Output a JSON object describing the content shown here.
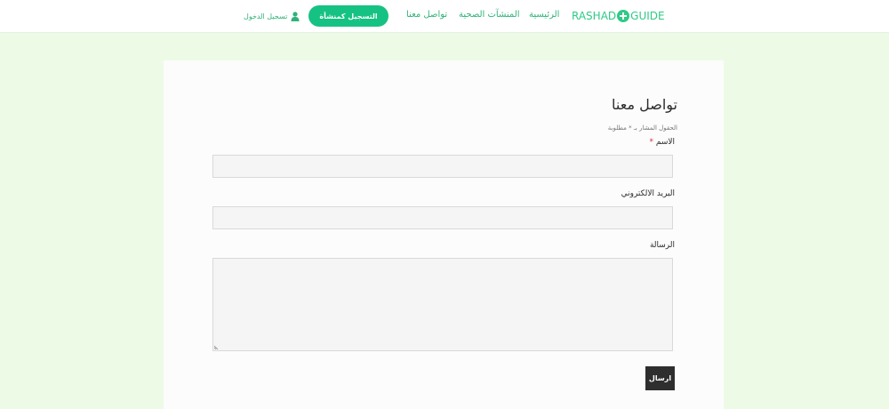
{
  "header": {
    "logo_left": "RASHAD",
    "logo_right": "GUIDE",
    "nav": {
      "home": "الرئيسية",
      "facilities": "المنشآت الصحية",
      "contact": "تواصل معنا"
    },
    "register_button": "التسجيل كمنشأة",
    "login": "تسجيل الدخول"
  },
  "form": {
    "title": "تواصل معنا",
    "required_note": "الحقول المشار بـ * مطلوبة",
    "name_label": "الاسم",
    "required_star": "*",
    "email_label": "البريد الالكتروني",
    "message_label": "الرسالة",
    "name_value": "",
    "email_value": "",
    "message_value": "",
    "submit_label": "ارسال"
  },
  "colors": {
    "accent": "#16c283",
    "page_background": "#edfbe6",
    "submit_background": "#2e2e2e",
    "required_star": "#d6303a"
  }
}
